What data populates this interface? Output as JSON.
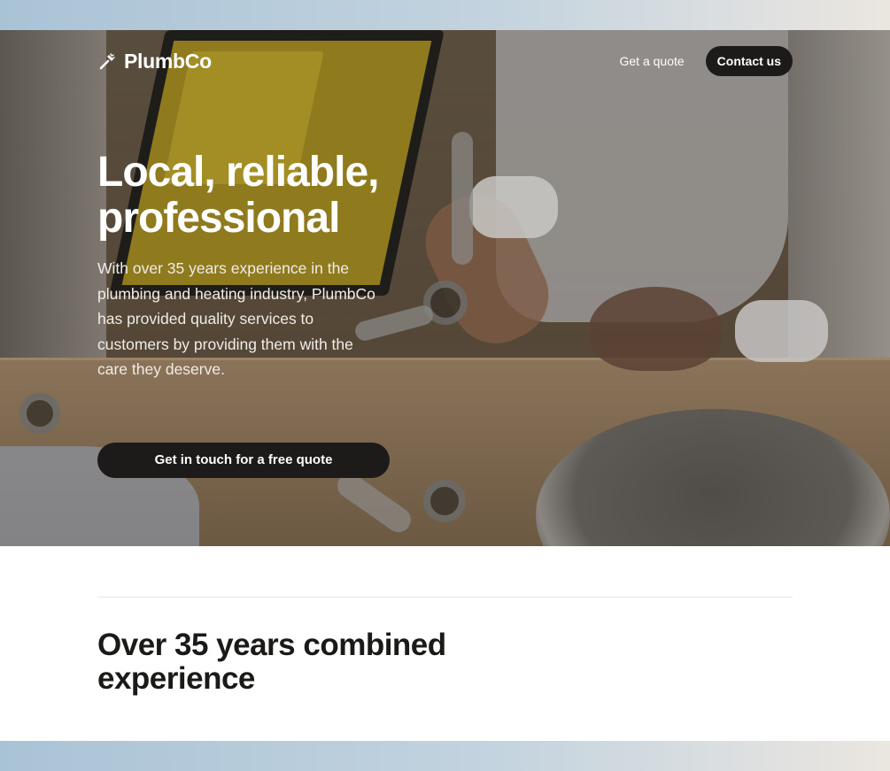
{
  "brand": {
    "name": "PlumbCo"
  },
  "nav": {
    "quote_link": "Get a quote",
    "contact_button": "Contact us"
  },
  "hero": {
    "title": "Local, reliable, professional",
    "description": "With over 35 years experience in the plumbing and heating industry, PlumbCo has provided quality services to customers by providing them with the care they deserve.",
    "cta": "Get in touch for a free quote"
  },
  "section": {
    "title": "Over 35 years combined experience"
  },
  "icons": {
    "logo": "wrench-sparkle-icon"
  },
  "colors": {
    "button_dark": "#1c1b1a",
    "text_dark": "#1b1a19",
    "hero_text": "#ffffff"
  }
}
